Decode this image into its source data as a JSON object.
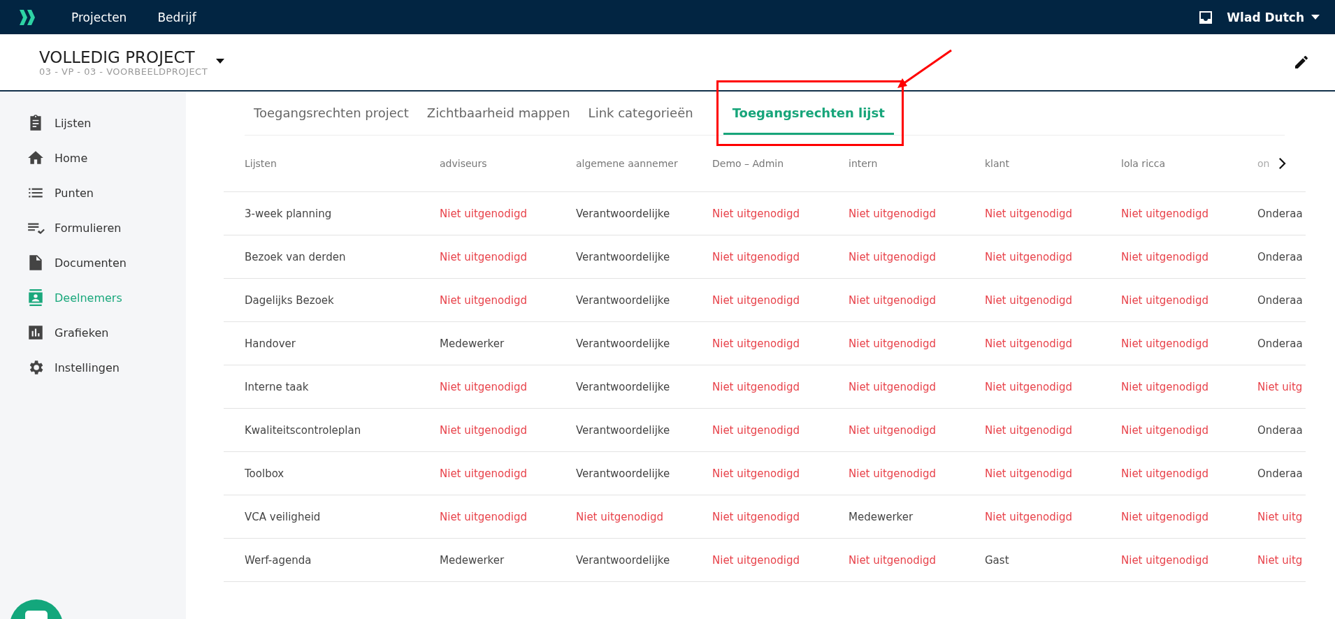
{
  "topbar": {
    "nav": [
      "Projecten",
      "Bedrijf"
    ],
    "user": "Wlad Dutch"
  },
  "project": {
    "title": "VOLLEDIG PROJECT",
    "subtitle": "03 - VP - 03 - VOORBEELDPROJECT"
  },
  "sidebar": {
    "items": [
      {
        "label": "Lijsten",
        "selected": false
      },
      {
        "label": "Home",
        "selected": false
      },
      {
        "label": "Punten",
        "selected": false
      },
      {
        "label": "Formulieren",
        "selected": false
      },
      {
        "label": "Documenten",
        "selected": false
      },
      {
        "label": "Deelnemers",
        "selected": true
      },
      {
        "label": "Grafieken",
        "selected": false
      },
      {
        "label": "Instellingen",
        "selected": false
      }
    ]
  },
  "tabs": [
    {
      "label": "Toegangsrechten project",
      "selected": false
    },
    {
      "label": "Zichtbaarheid mappen",
      "selected": false
    },
    {
      "label": "Link categorieën",
      "selected": false
    },
    {
      "label": "Toegangsrechten lijst",
      "selected": true
    }
  ],
  "table": {
    "columns": [
      "Lijsten",
      "adviseurs",
      "algemene aannemer",
      "Demo – Admin",
      "intern",
      "klant",
      "lola ricca",
      "on"
    ],
    "rows": [
      {
        "cells": [
          {
            "text": "3-week planning",
            "kind": "name"
          },
          {
            "text": "Niet uitgenodigd",
            "kind": "not_invited"
          },
          {
            "text": "Verantwoordelijke",
            "kind": "role"
          },
          {
            "text": "Niet uitgenodigd",
            "kind": "not_invited"
          },
          {
            "text": "Niet uitgenodigd",
            "kind": "not_invited"
          },
          {
            "text": "Niet uitgenodigd",
            "kind": "not_invited"
          },
          {
            "text": "Niet uitgenodigd",
            "kind": "not_invited"
          },
          {
            "text": "Onderaa",
            "kind": "role"
          }
        ]
      },
      {
        "cells": [
          {
            "text": "Bezoek van derden",
            "kind": "name"
          },
          {
            "text": "Niet uitgenodigd",
            "kind": "not_invited"
          },
          {
            "text": "Verantwoordelijke",
            "kind": "role"
          },
          {
            "text": "Niet uitgenodigd",
            "kind": "not_invited"
          },
          {
            "text": "Niet uitgenodigd",
            "kind": "not_invited"
          },
          {
            "text": "Niet uitgenodigd",
            "kind": "not_invited"
          },
          {
            "text": "Niet uitgenodigd",
            "kind": "not_invited"
          },
          {
            "text": "Onderaa",
            "kind": "role"
          }
        ]
      },
      {
        "cells": [
          {
            "text": "Dagelijks Bezoek",
            "kind": "name"
          },
          {
            "text": "Niet uitgenodigd",
            "kind": "not_invited"
          },
          {
            "text": "Verantwoordelijke",
            "kind": "role"
          },
          {
            "text": "Niet uitgenodigd",
            "kind": "not_invited"
          },
          {
            "text": "Niet uitgenodigd",
            "kind": "not_invited"
          },
          {
            "text": "Niet uitgenodigd",
            "kind": "not_invited"
          },
          {
            "text": "Niet uitgenodigd",
            "kind": "not_invited"
          },
          {
            "text": "Onderaa",
            "kind": "role"
          }
        ]
      },
      {
        "cells": [
          {
            "text": "Handover",
            "kind": "name"
          },
          {
            "text": "Medewerker",
            "kind": "role"
          },
          {
            "text": "Verantwoordelijke",
            "kind": "role"
          },
          {
            "text": "Niet uitgenodigd",
            "kind": "not_invited"
          },
          {
            "text": "Niet uitgenodigd",
            "kind": "not_invited"
          },
          {
            "text": "Niet uitgenodigd",
            "kind": "not_invited"
          },
          {
            "text": "Niet uitgenodigd",
            "kind": "not_invited"
          },
          {
            "text": "Onderaa",
            "kind": "role"
          }
        ]
      },
      {
        "cells": [
          {
            "text": "Interne taak",
            "kind": "name"
          },
          {
            "text": "Niet uitgenodigd",
            "kind": "not_invited"
          },
          {
            "text": "Verantwoordelijke",
            "kind": "role"
          },
          {
            "text": "Niet uitgenodigd",
            "kind": "not_invited"
          },
          {
            "text": "Niet uitgenodigd",
            "kind": "not_invited"
          },
          {
            "text": "Niet uitgenodigd",
            "kind": "not_invited"
          },
          {
            "text": "Niet uitgenodigd",
            "kind": "not_invited"
          },
          {
            "text": "Niet uitg",
            "kind": "not_invited"
          }
        ]
      },
      {
        "cells": [
          {
            "text": "Kwaliteitscontroleplan",
            "kind": "name"
          },
          {
            "text": "Niet uitgenodigd",
            "kind": "not_invited"
          },
          {
            "text": "Verantwoordelijke",
            "kind": "role"
          },
          {
            "text": "Niet uitgenodigd",
            "kind": "not_invited"
          },
          {
            "text": "Niet uitgenodigd",
            "kind": "not_invited"
          },
          {
            "text": "Niet uitgenodigd",
            "kind": "not_invited"
          },
          {
            "text": "Niet uitgenodigd",
            "kind": "not_invited"
          },
          {
            "text": "Onderaa",
            "kind": "role"
          }
        ]
      },
      {
        "cells": [
          {
            "text": "Toolbox",
            "kind": "name"
          },
          {
            "text": "Niet uitgenodigd",
            "kind": "not_invited"
          },
          {
            "text": "Verantwoordelijke",
            "kind": "role"
          },
          {
            "text": "Niet uitgenodigd",
            "kind": "not_invited"
          },
          {
            "text": "Niet uitgenodigd",
            "kind": "not_invited"
          },
          {
            "text": "Niet uitgenodigd",
            "kind": "not_invited"
          },
          {
            "text": "Niet uitgenodigd",
            "kind": "not_invited"
          },
          {
            "text": "Onderaa",
            "kind": "role"
          }
        ]
      },
      {
        "cells": [
          {
            "text": "VCA veiligheid",
            "kind": "name"
          },
          {
            "text": "Niet uitgenodigd",
            "kind": "not_invited"
          },
          {
            "text": "Niet uitgenodigd",
            "kind": "not_invited"
          },
          {
            "text": "Niet uitgenodigd",
            "kind": "not_invited"
          },
          {
            "text": "Medewerker",
            "kind": "role"
          },
          {
            "text": "Niet uitgenodigd",
            "kind": "not_invited"
          },
          {
            "text": "Niet uitgenodigd",
            "kind": "not_invited"
          },
          {
            "text": "Niet uitg",
            "kind": "not_invited"
          }
        ]
      },
      {
        "cells": [
          {
            "text": "Werf-agenda",
            "kind": "name"
          },
          {
            "text": "Medewerker",
            "kind": "role"
          },
          {
            "text": "Verantwoordelijke",
            "kind": "role"
          },
          {
            "text": "Niet uitgenodigd",
            "kind": "not_invited"
          },
          {
            "text": "Niet uitgenodigd",
            "kind": "not_invited"
          },
          {
            "text": "Gast",
            "kind": "role"
          },
          {
            "text": "Niet uitgenodigd",
            "kind": "not_invited"
          },
          {
            "text": "Niet uitg",
            "kind": "not_invited"
          }
        ]
      }
    ]
  }
}
